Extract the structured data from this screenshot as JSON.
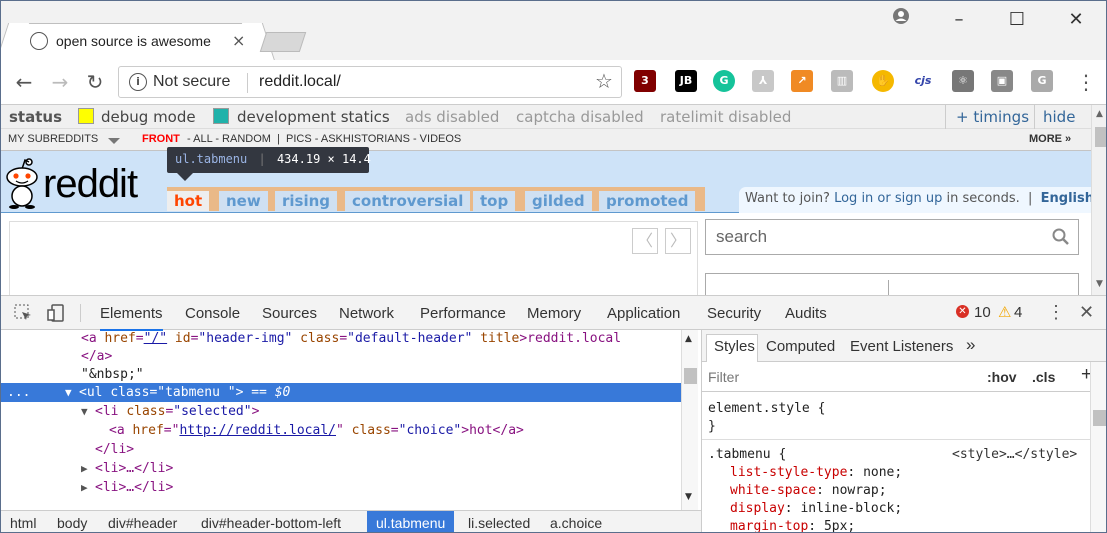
{
  "browser": {
    "tab_title": "open source is awesome",
    "tab_close": "×",
    "window_controls": {
      "minimize": "–",
      "maximize": "☐",
      "close": "✕",
      "profile_icon": "person-icon"
    },
    "nav": {
      "back": "←",
      "forward": "→",
      "reload": "↻"
    },
    "omnibox": {
      "security": "Not secure",
      "url": "reddit.local/",
      "info_glyph": "i",
      "star": "☆"
    },
    "extensions": [
      {
        "name": "ublock-icon",
        "label": "3",
        "color": "#800000"
      },
      {
        "name": "jb-icon",
        "label": "JB",
        "color": "#000000"
      },
      {
        "name": "grammarly-icon",
        "label": "G",
        "color": "#15c39a"
      },
      {
        "name": "pdf-icon",
        "label": "⅄",
        "color": "#c8c8c8"
      },
      {
        "name": "chart-icon",
        "label": "↗",
        "color": "#f08a24"
      },
      {
        "name": "trello-icon",
        "label": "▥",
        "color": "#bbbbbb"
      },
      {
        "name": "honey-icon",
        "label": "✋",
        "color": "#f5b800"
      },
      {
        "name": "cjs-icon",
        "label": "cjs",
        "color": "#ffffff"
      },
      {
        "name": "react-icon",
        "label": "⚛",
        "color": "#777777"
      },
      {
        "name": "robot-icon",
        "label": "▣",
        "color": "#888888"
      },
      {
        "name": "g-ext-icon",
        "label": "G",
        "color": "#aaaaaa"
      }
    ],
    "menu": "⋮"
  },
  "reddit": {
    "debugbar": {
      "status": "status",
      "debug_mode": "debug mode",
      "dev_statics": "development statics",
      "ads": "ads disabled",
      "captcha": "captcha disabled",
      "ratelimit": "ratelimit disabled",
      "timings": "+ timings",
      "hide": "hide",
      "debug_color": "#ffff00",
      "statics_color": "#20b2aa"
    },
    "srbar": {
      "my_subreddits": "MY SUBREDDITS",
      "front": "FRONT",
      "links": "- ALL - RANDOM  |  PICS - ASKHISTORIANS - VIDEOS",
      "more": "MORE »"
    },
    "logo_text": "reddit",
    "tooltip": {
      "selector": "ul.tabmenu",
      "size": "434.19 × 14.4"
    },
    "tabs": [
      "hot",
      "new",
      "rising",
      "controversial",
      "top",
      "gilded",
      "promoted"
    ],
    "userbox": {
      "prefix": "Want to join? ",
      "login": "Log in or sign up",
      "suffix": " in seconds.  |  ",
      "lang": "English"
    },
    "search_placeholder": "search",
    "pager": {
      "prev": "〈",
      "next": "〉"
    }
  },
  "devtools": {
    "tabs": [
      "Elements",
      "Console",
      "Sources",
      "Network",
      "Performance",
      "Memory",
      "Application",
      "Security",
      "Audits"
    ],
    "errors": "10",
    "warnings": "4",
    "code": {
      "l1": {
        "open": "<a ",
        "href_attr": "href",
        "href_val": "\"/\"",
        "id_attr": " id",
        "id_val": "\"header-img\"",
        "cls_attr": " class",
        "cls_val": "\"default-header\"",
        "title_attr": " title",
        "tail": ">reddit.local"
      },
      "l2": "</a>",
      "l3": "\"&nbsp;\"",
      "l4": {
        "dots": "...",
        "arrow": "▼",
        "open": "<ul ",
        "attr": "class",
        "val": "\"tabmenu \"",
        "close": ">",
        "eq": " == ",
        "var": "$0"
      },
      "l5": {
        "arrow": "▼",
        "open": "<li ",
        "attr": "class",
        "val": "\"selected\"",
        "close": ">"
      },
      "l6": {
        "open": "<a ",
        "attr": "href",
        "link": "http://reddit.local/",
        "attr2": " class",
        "val2": "\"choice\"",
        "tail": ">hot</a>"
      },
      "l7": "</li>",
      "l8": {
        "arrow": "▶",
        "text": "<li>…</li>"
      },
      "l9": {
        "arrow": "▶",
        "text": "<li>…</li>"
      }
    },
    "breadcrumbs": [
      "html",
      "body",
      "div#header",
      "div#header-bottom-left",
      "ul.tabmenu",
      "li.selected",
      "a.choice"
    ],
    "styles": {
      "tabs": [
        "Styles",
        "Computed",
        "Event Listeners",
        "»"
      ],
      "filter": "Filter",
      "hov": ":hov",
      "cls": ".cls",
      "plus": "+",
      "element_style": "element.style {",
      "close_brace": "}",
      "tabmenu_selector": ".tabmenu {",
      "source": "<style>…</style>",
      "props": [
        {
          "name": "list-style-type",
          "value": "none;"
        },
        {
          "name": "white-space",
          "value": "nowrap;"
        },
        {
          "name": "display",
          "value": "inline-block;"
        },
        {
          "name": "margin-top",
          "value": "5px;"
        }
      ]
    }
  }
}
